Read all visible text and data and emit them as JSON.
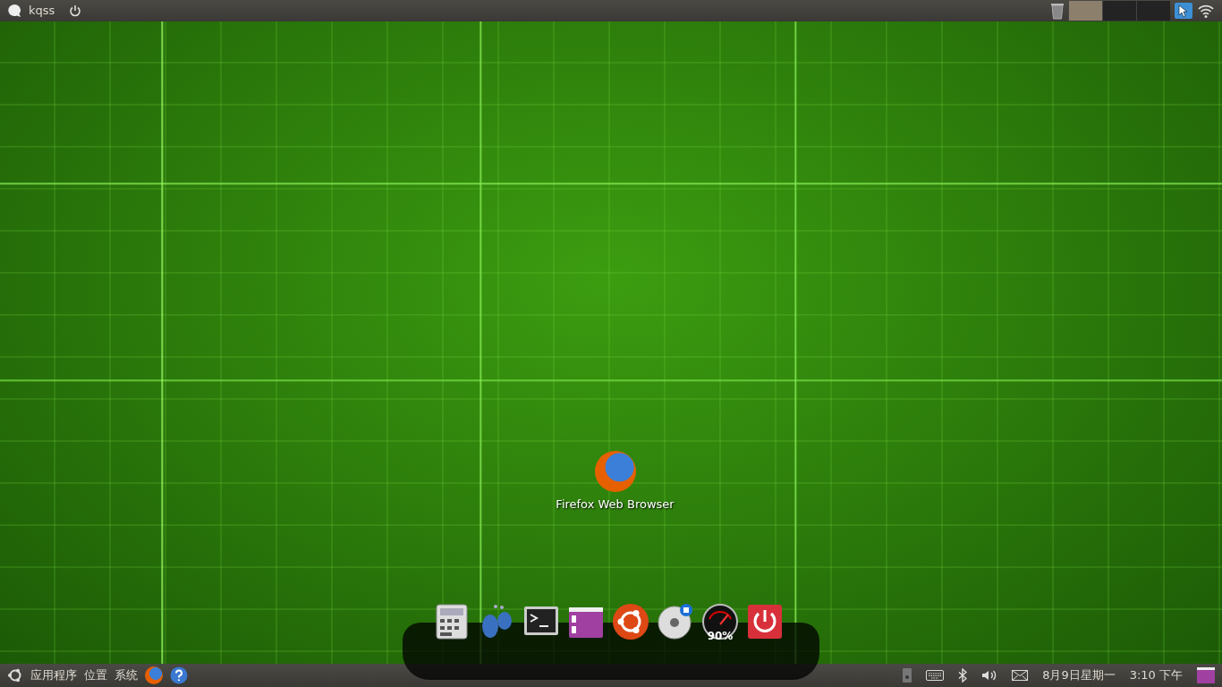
{
  "top_panel": {
    "user": "kqss",
    "workspaces": [
      {
        "selected": true
      },
      {
        "selected": false
      },
      {
        "selected": false
      }
    ]
  },
  "desktop_icons": [
    {
      "label": "Firefox Web Browser"
    }
  ],
  "dock": [
    {
      "kind": "calculator"
    },
    {
      "kind": "footprints"
    },
    {
      "kind": "terminal"
    },
    {
      "kind": "window"
    },
    {
      "kind": "ubuntu"
    },
    {
      "kind": "disc"
    },
    {
      "kind": "gauge",
      "reading": "90%"
    },
    {
      "kind": "power"
    }
  ],
  "bottom_panel": {
    "menus": [
      "应用程序",
      "位置",
      "系统"
    ],
    "date": "8月9日星期一",
    "time": "3:10 下午"
  }
}
